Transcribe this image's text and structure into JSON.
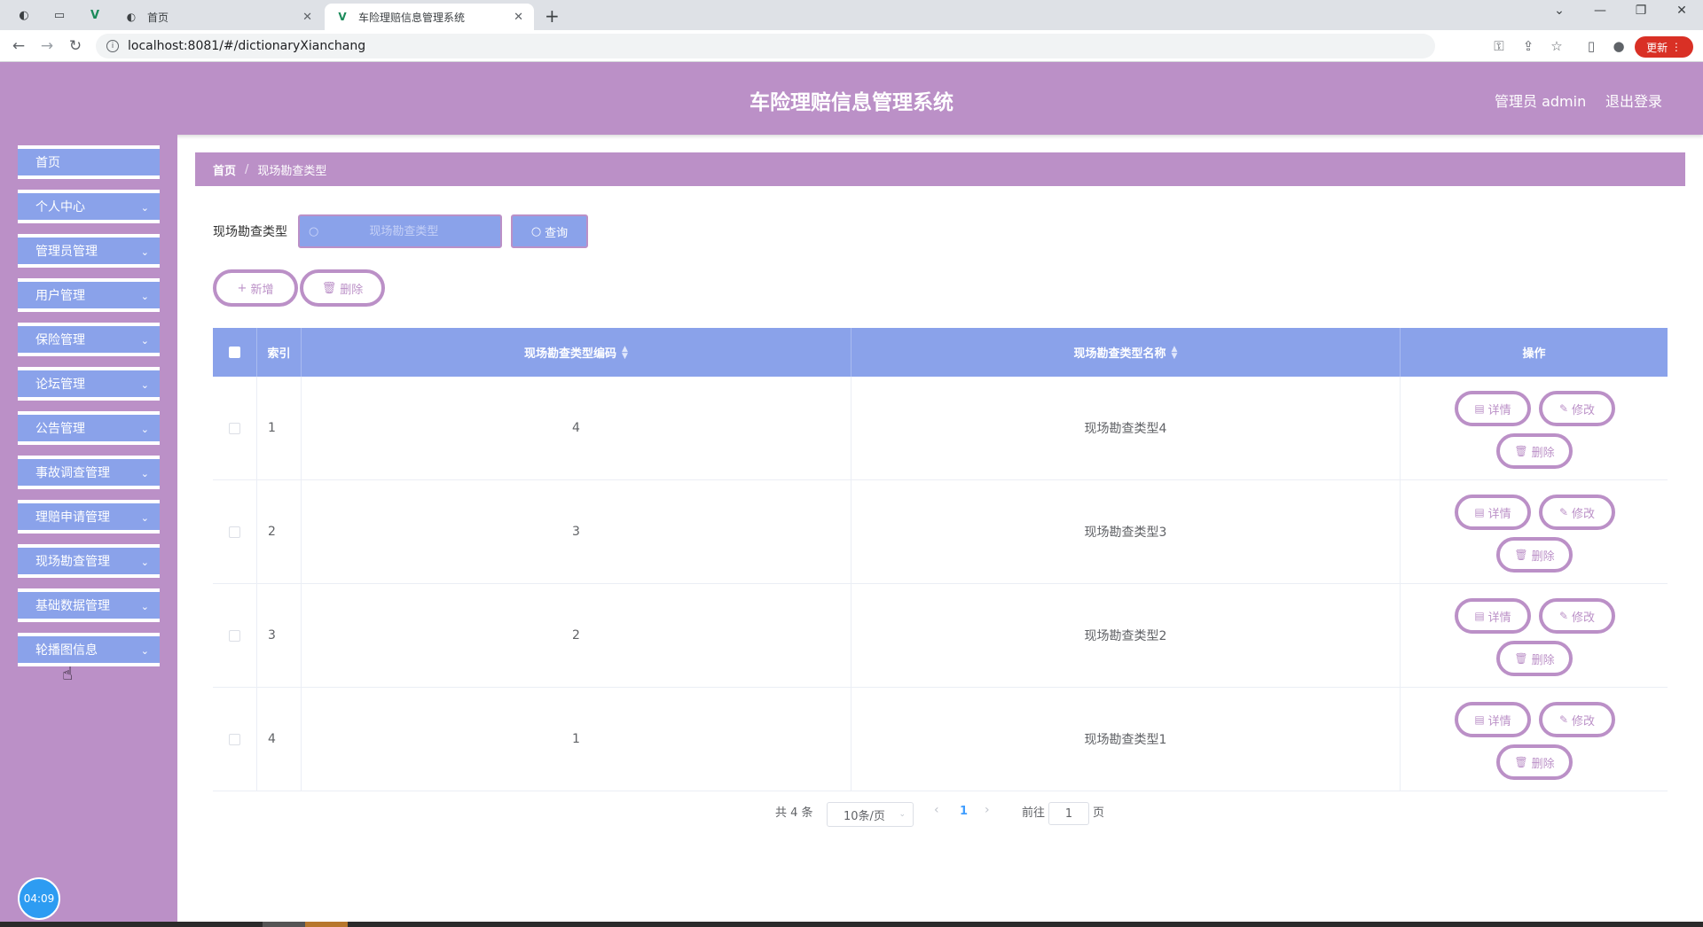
{
  "browser": {
    "tabs": [
      {
        "title": "首页",
        "icon": "globe-icon"
      },
      {
        "title": "车险理赔信息管理系统",
        "icon": "vue-icon"
      }
    ],
    "url": "localhost:8081/#/dictionaryXianchang",
    "update_label": "更新"
  },
  "header": {
    "title": "车险理赔信息管理系统",
    "user": "管理员 admin",
    "logout": "退出登录"
  },
  "sidebar": {
    "items": [
      {
        "label": "首页",
        "expandable": false
      },
      {
        "label": "个人中心",
        "expandable": true
      },
      {
        "label": "管理员管理",
        "expandable": true
      },
      {
        "label": "用户管理",
        "expandable": true
      },
      {
        "label": "保险管理",
        "expandable": true
      },
      {
        "label": "论坛管理",
        "expandable": true
      },
      {
        "label": "公告管理",
        "expandable": true
      },
      {
        "label": "事故调查管理",
        "expandable": true
      },
      {
        "label": "理赔申请管理",
        "expandable": true
      },
      {
        "label": "现场勘查管理",
        "expandable": true
      },
      {
        "label": "基础数据管理",
        "expandable": true
      },
      {
        "label": "轮播图信息",
        "expandable": true
      }
    ],
    "clock": "04:09"
  },
  "breadcrumb": {
    "home": "首页",
    "current": "现场勘查类型"
  },
  "search": {
    "label": "现场勘查类型",
    "placeholder": "现场勘查类型",
    "button": "查询"
  },
  "actions": {
    "add": "新增",
    "delete": "删除"
  },
  "table": {
    "columns": {
      "index": "索引",
      "code": "现场勘查类型编码",
      "name": "现场勘查类型名称",
      "ops": "操作"
    },
    "rows": [
      {
        "index": "1",
        "code": "4",
        "name": "现场勘查类型4"
      },
      {
        "index": "2",
        "code": "3",
        "name": "现场勘查类型3"
      },
      {
        "index": "3",
        "code": "2",
        "name": "现场勘查类型2"
      },
      {
        "index": "4",
        "code": "1",
        "name": "现场勘查类型1"
      }
    ],
    "op_labels": {
      "detail": "详情",
      "edit": "修改",
      "delete": "删除"
    }
  },
  "pagination": {
    "total": "共 4 条",
    "page_size": "10条/页",
    "current": "1",
    "goto_label": "前往",
    "goto_value": "1",
    "page_unit": "页"
  }
}
